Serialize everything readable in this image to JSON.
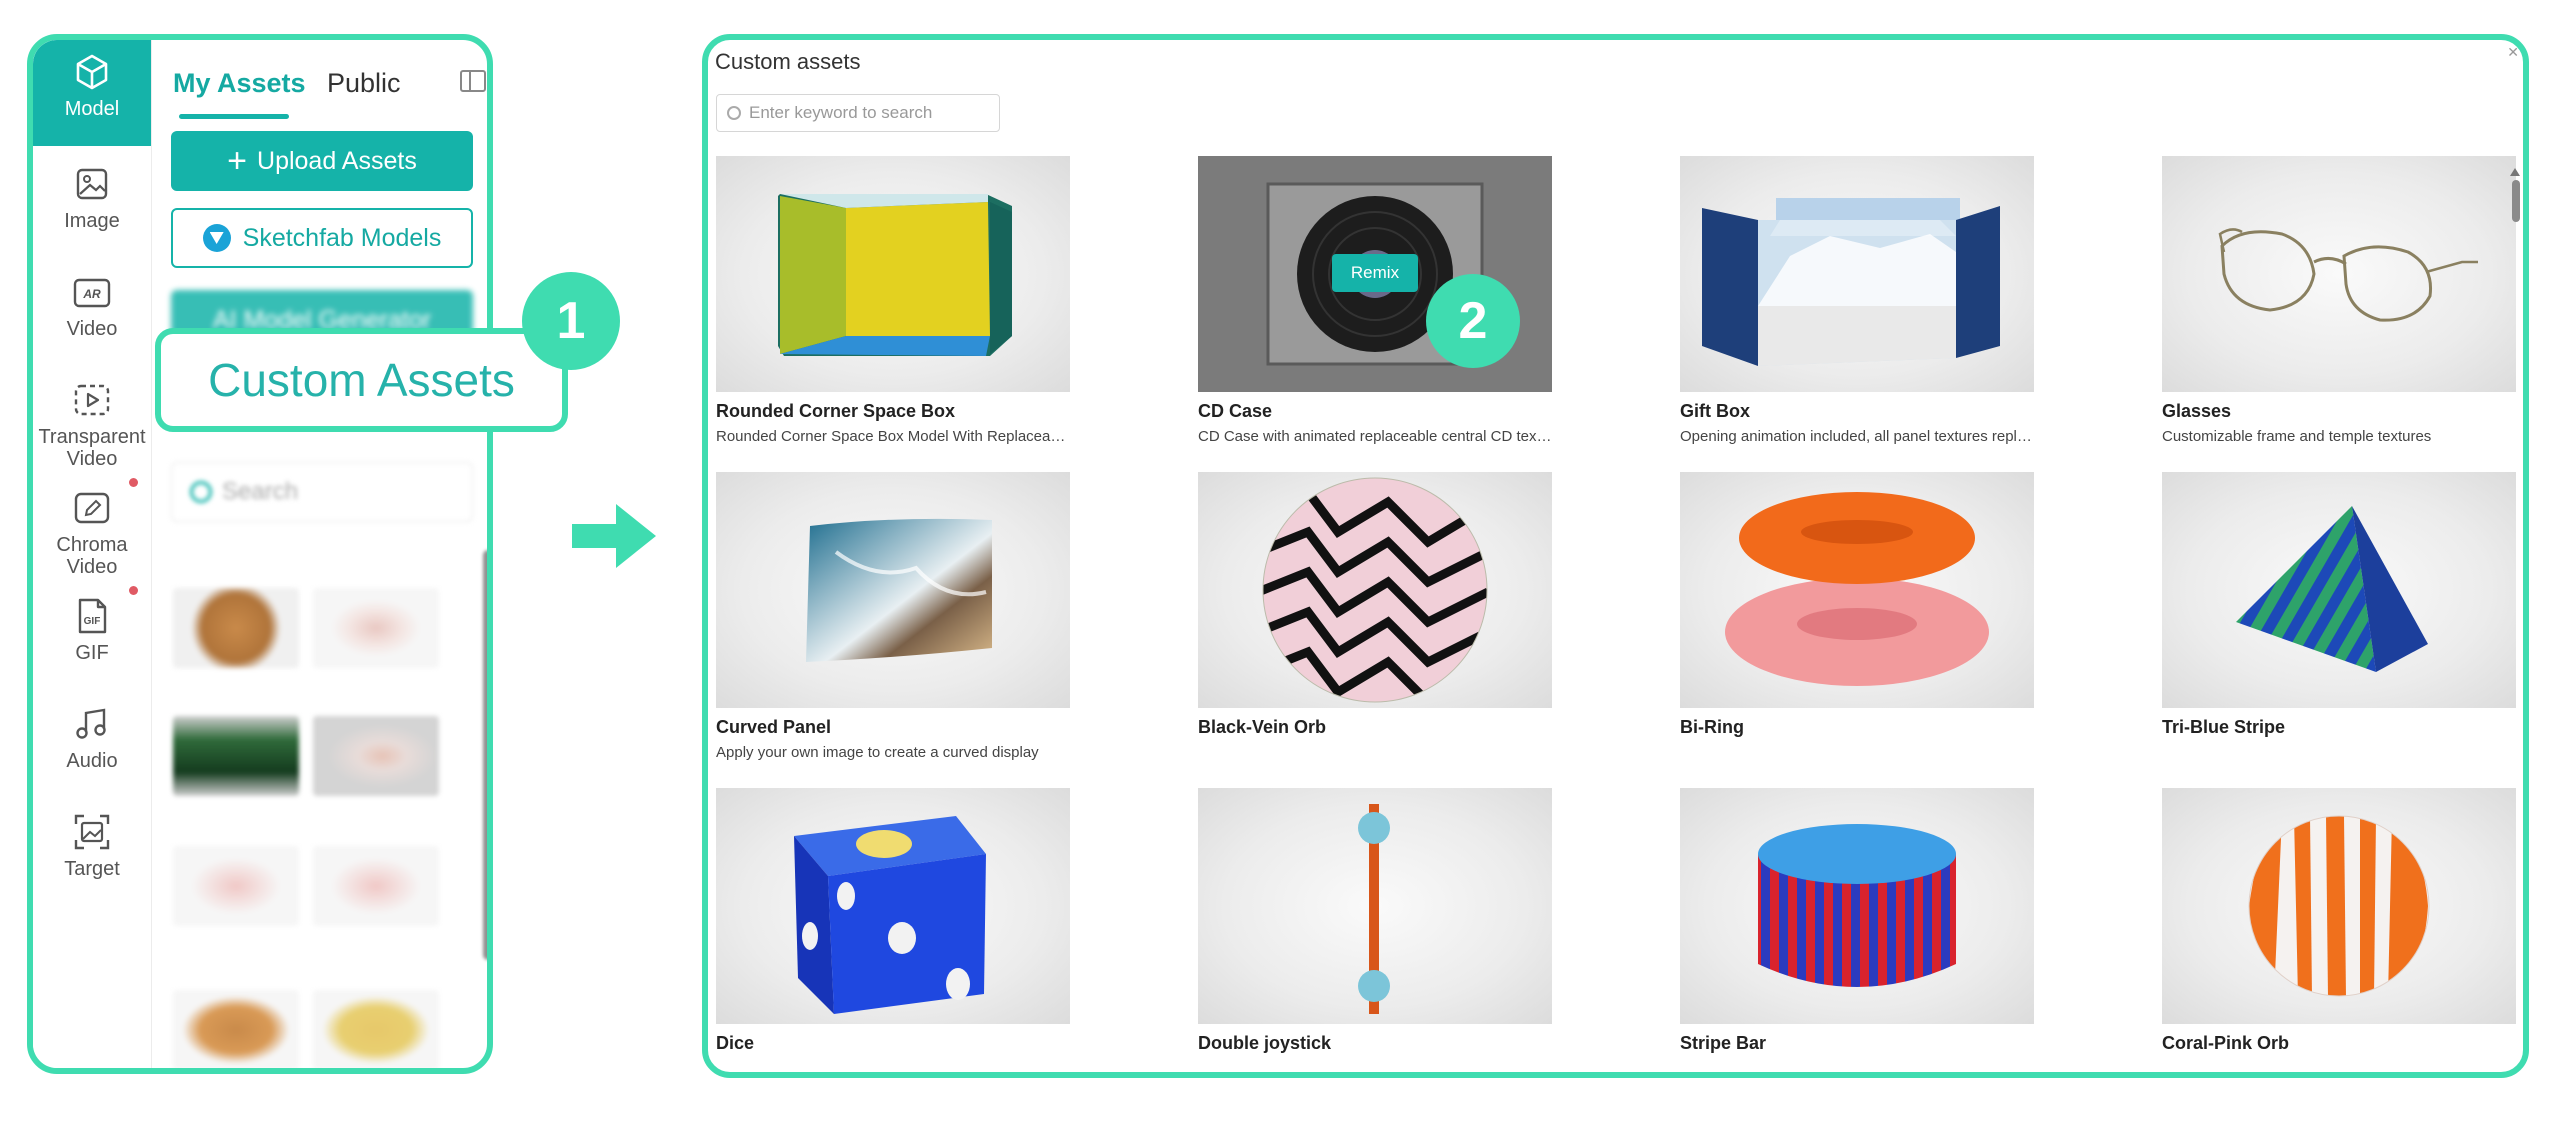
{
  "left_panel": {
    "rail": [
      {
        "label": "Model",
        "icon": "cube-icon",
        "active": true
      },
      {
        "label": "Image",
        "icon": "image-icon"
      },
      {
        "label": "Video",
        "icon": "ar-icon"
      },
      {
        "label": "Transparent Video",
        "icon": "play-dashed-icon"
      },
      {
        "label": "Chroma Video",
        "icon": "edit-icon",
        "dot": true
      },
      {
        "label": "GIF",
        "icon": "gif-file-icon",
        "dot": true
      },
      {
        "label": "Audio",
        "icon": "music-note-icon"
      },
      {
        "label": "Target",
        "icon": "target-scan-icon"
      }
    ],
    "tabs": {
      "my_assets": "My Assets",
      "public": "Public"
    },
    "upload_label": "Upload Assets",
    "sketchfab_label": "Sketchfab Models",
    "ai_label": "AI Model Generator",
    "search_placeholder": "Search"
  },
  "callout_1": {
    "label": "Custom Assets",
    "badge": "1"
  },
  "badge_2": "2",
  "right_panel": {
    "title": "Custom assets",
    "search_placeholder": "Enter keyword to search",
    "remix_label": "Remix",
    "cards": [
      {
        "name": "Rounded Corner Space Box",
        "desc": "Rounded Corner Space Box Model With Replaceable…"
      },
      {
        "name": "CD Case",
        "desc": "CD Case with animated replaceable central CD texture"
      },
      {
        "name": "Gift Box",
        "desc": "Opening animation included, all panel textures repl…"
      },
      {
        "name": "Glasses",
        "desc": "Customizable frame and temple textures"
      },
      {
        "name": "Curved Panel",
        "desc": "Apply your own image to create a curved display"
      },
      {
        "name": "Black-Vein Orb",
        "desc": ""
      },
      {
        "name": "Bi-Ring",
        "desc": ""
      },
      {
        "name": "Tri-Blue Stripe",
        "desc": ""
      },
      {
        "name": "Dice",
        "desc": ""
      },
      {
        "name": "Double joystick",
        "desc": ""
      },
      {
        "name": "Stripe Bar",
        "desc": ""
      },
      {
        "name": "Coral-Pink Orb",
        "desc": ""
      }
    ]
  },
  "colors": {
    "accent": "#15b3a9",
    "highlight": "#3fdcb0",
    "notification": "#e05a64"
  }
}
